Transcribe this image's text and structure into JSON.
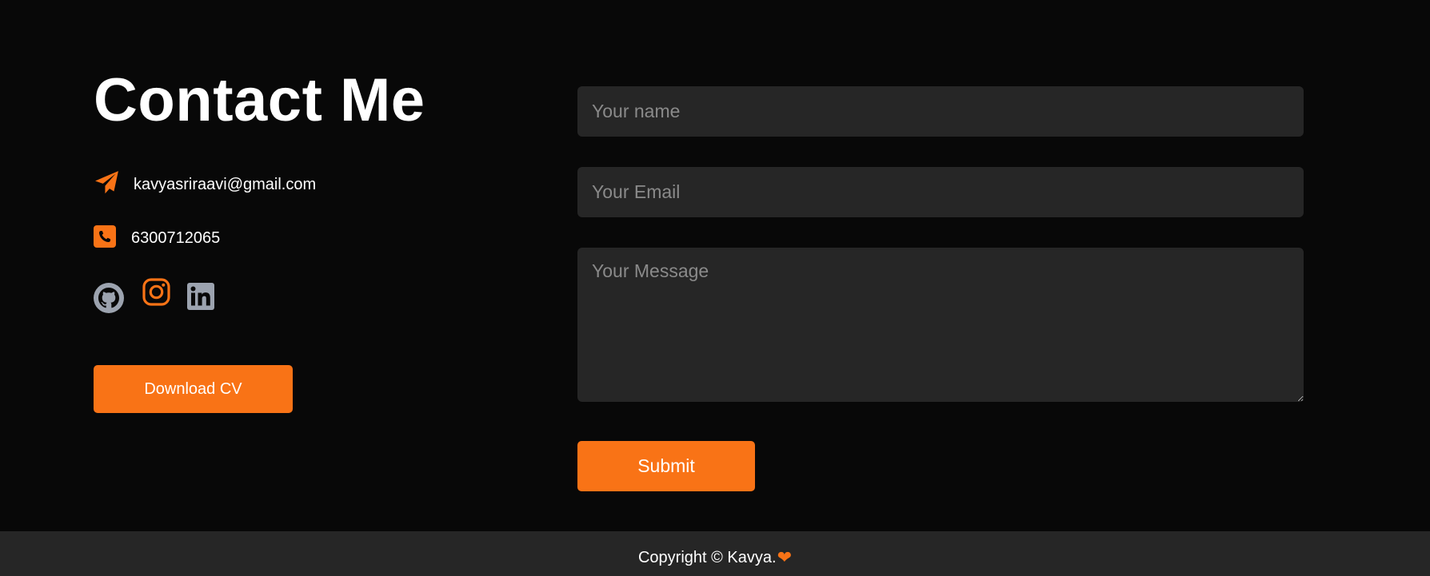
{
  "colors": {
    "accent": "#f97316",
    "background": "#080808",
    "panel": "#262626"
  },
  "contact": {
    "title": "Contact Me",
    "email": "kavyasriraavi@gmail.com",
    "phone": "6300712065",
    "icons": {
      "email": "paper-plane-icon",
      "phone": "phone-icon"
    },
    "socials": [
      {
        "name": "github",
        "icon": "github-icon"
      },
      {
        "name": "instagram",
        "icon": "instagram-icon"
      },
      {
        "name": "linkedin",
        "icon": "linkedin-icon"
      }
    ],
    "cv_button": "Download CV"
  },
  "form": {
    "name_placeholder": "Your name",
    "email_placeholder": "Your Email",
    "message_placeholder": "Your Message",
    "submit_label": "Submit"
  },
  "footer": {
    "text": "Copyright © Kavya.",
    "heart": "❤"
  }
}
